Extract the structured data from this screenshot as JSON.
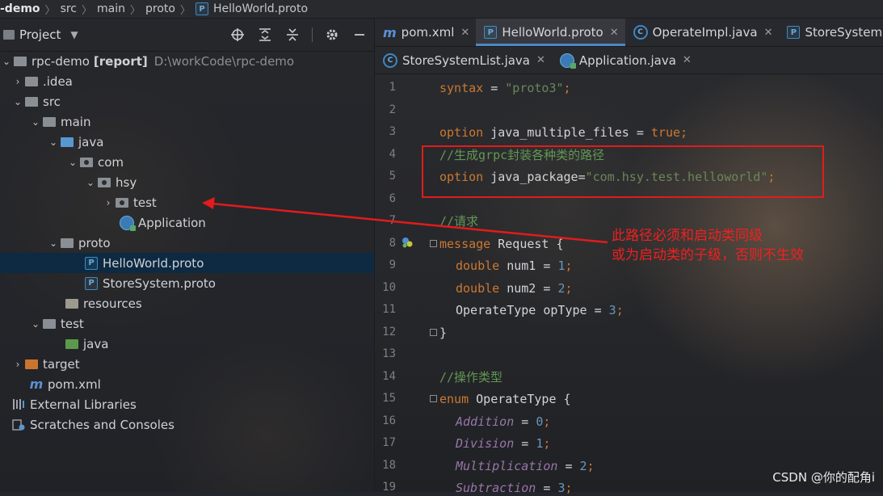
{
  "breadcrumb": {
    "items": [
      "-demo",
      "src",
      "main",
      "proto",
      "HelloWorld.proto"
    ]
  },
  "project": {
    "title": "Project",
    "tree": [
      {
        "label": "rpc-demo",
        "extra": "[report]",
        "path": "D:\\workCode\\rpc-demo",
        "icon": "folder-icon"
      },
      {
        "label": ".idea",
        "icon": "folder-icon"
      },
      {
        "label": "src",
        "icon": "folder-icon"
      },
      {
        "label": "main",
        "icon": "folder-icon"
      },
      {
        "label": "java",
        "icon": "source-folder-icon"
      },
      {
        "label": "com",
        "icon": "package-icon"
      },
      {
        "label": "hsy",
        "icon": "package-icon"
      },
      {
        "label": "test",
        "icon": "package-icon"
      },
      {
        "label": "Application",
        "icon": "spring-boot-class-icon"
      },
      {
        "label": "proto",
        "icon": "folder-icon"
      },
      {
        "label": "HelloWorld.proto",
        "icon": "proto-file-icon"
      },
      {
        "label": "StoreSystem.proto",
        "icon": "proto-file-icon"
      },
      {
        "label": "resources",
        "icon": "resources-folder-icon"
      },
      {
        "label": "test",
        "icon": "folder-icon"
      },
      {
        "label": "java",
        "icon": "test-source-folder-icon"
      },
      {
        "label": "target",
        "icon": "excluded-folder-icon"
      },
      {
        "label": "pom.xml",
        "icon": "maven-icon"
      },
      {
        "label": "External Libraries",
        "icon": "library-icon"
      },
      {
        "label": "Scratches and Consoles",
        "icon": "scratches-icon"
      }
    ]
  },
  "tabs_row1": [
    "pom.xml",
    "HelloWorld.proto",
    "OperateImpl.java",
    "StoreSystem"
  ],
  "tabs_row2": [
    "StoreSystemList.java",
    "Application.java"
  ],
  "code": {
    "line_numbers": [
      "1",
      "2",
      "3",
      "4",
      "5",
      "6",
      "7",
      "8",
      "9",
      "10",
      "11",
      "12",
      "13",
      "14",
      "15",
      "16",
      "17",
      "18",
      "19"
    ],
    "l1a": "syntax",
    "l1b": " = ",
    "l1c": "\"proto3\"",
    "l1d": ";",
    "l3a": "option",
    "l3b": " java_multiple_files = ",
    "l3c": "true",
    "l3d": ";",
    "l4": "//生成grpc封装各种类的路径",
    "l5a": "option",
    "l5b": " java_package=",
    "l5c": "\"com.hsy.test.helloworld\"",
    "l5d": ";",
    "l7": "//请求",
    "l8a": "message",
    "l8b": " Request {",
    "l9a": "double",
    "l9b": " num1 = ",
    "l9c": "1",
    "l9d": ";",
    "l10a": "double",
    "l10b": " num2 = ",
    "l10c": "2",
    "l10d": ";",
    "l11a": "OperateType opType = ",
    "l11b": "3",
    "l11c": ";",
    "l12": "}",
    "l14": "//操作类型",
    "l15a": "enum",
    "l15b": " OperateType {",
    "l16a": "Addition",
    "l16b": " = ",
    "l16c": "0",
    "l16d": ";",
    "l17a": "Division",
    "l17b": " = ",
    "l17c": "1",
    "l17d": ";",
    "l18a": "Multiplication",
    "l18b": " = ",
    "l18c": "2",
    "l18d": ";",
    "l19a": "Subtraction",
    "l19b": " = ",
    "l19c": "3",
    "l19d": ";"
  },
  "annotation": {
    "line1": "此路径必须和启动类同级",
    "line2": "或为启动类的子级，否则不生效"
  },
  "watermark": "CSDN @你的配角i",
  "colors": {
    "annotation_red": "#e21b1b",
    "selection": "#0d2a42",
    "tab_accent": "#4a88c7"
  }
}
